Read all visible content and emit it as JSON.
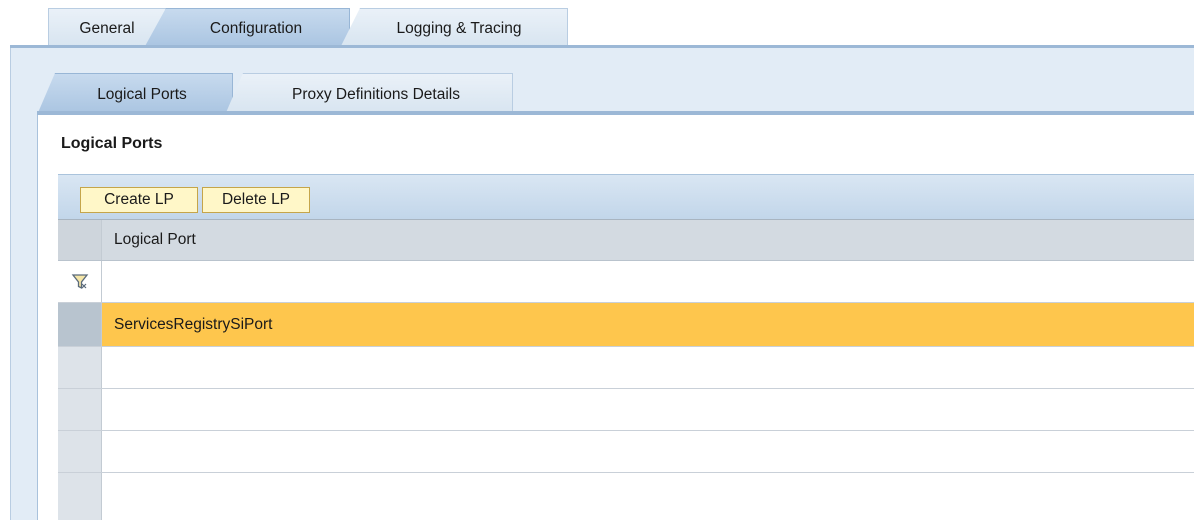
{
  "outer_tabs": [
    {
      "label": "General",
      "active": false
    },
    {
      "label": "Configuration",
      "active": true
    },
    {
      "label": "Logging & Tracing",
      "active": false
    }
  ],
  "inner_tabs": [
    {
      "label": "Logical Ports",
      "active": true
    },
    {
      "label": "Proxy Definitions Details",
      "active": false
    }
  ],
  "section": {
    "title": "Logical Ports"
  },
  "toolbar": {
    "create_label": "Create LP",
    "delete_label": "Delete LP"
  },
  "table": {
    "columns": [
      "Logical Port"
    ],
    "filter_value": "",
    "rows": [
      {
        "logical_port": "ServicesRegistrySiPort",
        "selected": true
      },
      {
        "logical_port": ""
      },
      {
        "logical_port": ""
      },
      {
        "logical_port": ""
      },
      {
        "logical_port": ""
      }
    ]
  },
  "icons": {
    "filter": "filter-funnel-icon"
  },
  "colors": {
    "selected_row": "#fec64d",
    "tab_active": "#a9c4e1",
    "button": "#fff7c8"
  }
}
